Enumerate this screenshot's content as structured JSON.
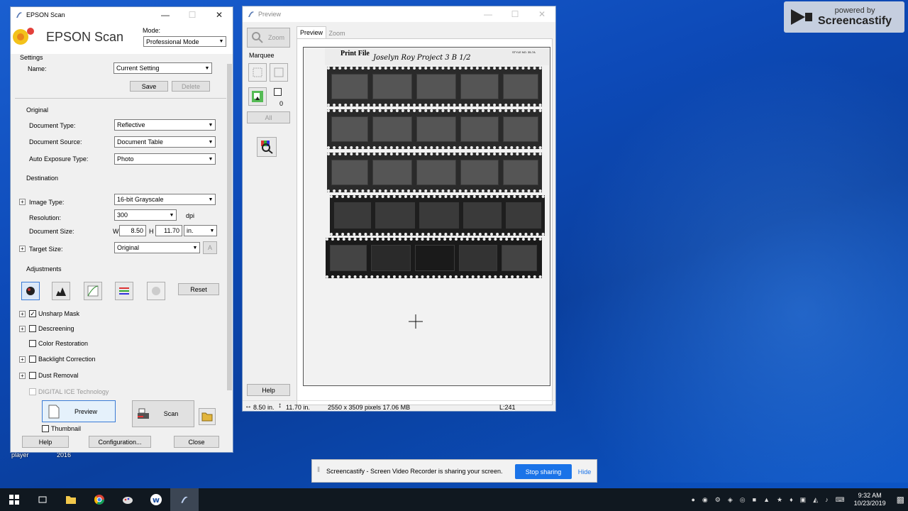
{
  "desktop": {
    "icon_labels": [
      "player",
      "2016"
    ]
  },
  "screencastify": {
    "powered_by": "powered by",
    "brand": "Screencastify",
    "share_message": "Screencastify - Screen Video Recorder is sharing your screen.",
    "stop_label": "Stop sharing",
    "hide_label": "Hide"
  },
  "epson": {
    "window_title": "EPSON Scan",
    "logo_text": "EPSON Scan",
    "mode_label": "Mode:",
    "mode_value": "Professional Mode",
    "settings_label": "Settings",
    "name_label": "Name:",
    "name_value": "Current Setting",
    "save_label": "Save",
    "delete_label": "Delete",
    "original_label": "Original",
    "doc_type_label": "Document Type:",
    "doc_type_value": "Reflective",
    "doc_source_label": "Document Source:",
    "doc_source_value": "Document Table",
    "auto_exposure_label": "Auto Exposure Type:",
    "auto_exposure_value": "Photo",
    "destination_label": "Destination",
    "image_type_label": "Image Type:",
    "image_type_value": "16-bit Grayscale",
    "resolution_label": "Resolution:",
    "resolution_value": "300",
    "resolution_unit": "dpi",
    "doc_size_label": "Document Size:",
    "width_label": "W",
    "width_value": "8.50",
    "height_label": "H",
    "height_value": "11.70",
    "size_unit": "in.",
    "target_size_label": "Target Size:",
    "target_size_value": "Original",
    "adjustments_label": "Adjustments",
    "reset_label": "Reset",
    "unsharp_label": "Unsharp Mask",
    "descreening_label": "Descreening",
    "color_restoration_label": "Color Restoration",
    "backlight_label": "Backlight Correction",
    "dust_label": "Dust Removal",
    "digital_ice_label": "DIGITAL ICE Technology",
    "preview_label": "Preview",
    "scan_label": "Scan",
    "thumbnail_label": "Thumbnail",
    "help_label": "Help",
    "config_label": "Configuration...",
    "close_label": "Close"
  },
  "preview": {
    "window_title": "Preview",
    "zoom_label": "Zoom",
    "marquee_label": "Marquee",
    "marquee_count": "0",
    "all_label": "All",
    "tab_preview": "Preview",
    "tab_zoom": "Zoom",
    "help_label": "Help",
    "status_width": "8.50 in.",
    "status_height": "11.70 in.",
    "status_pixels": "2550 x 3509 pixels 17.06 MB",
    "status_level": "L:241",
    "sleeve": {
      "brand": "Print File",
      "handwriting": "Joselyn Roy   Project 3   B 1/2",
      "style_no": "STYLE NO. 35-7A"
    }
  },
  "taskbar": {
    "time": "9:32 AM",
    "date": "10/23/2019"
  }
}
